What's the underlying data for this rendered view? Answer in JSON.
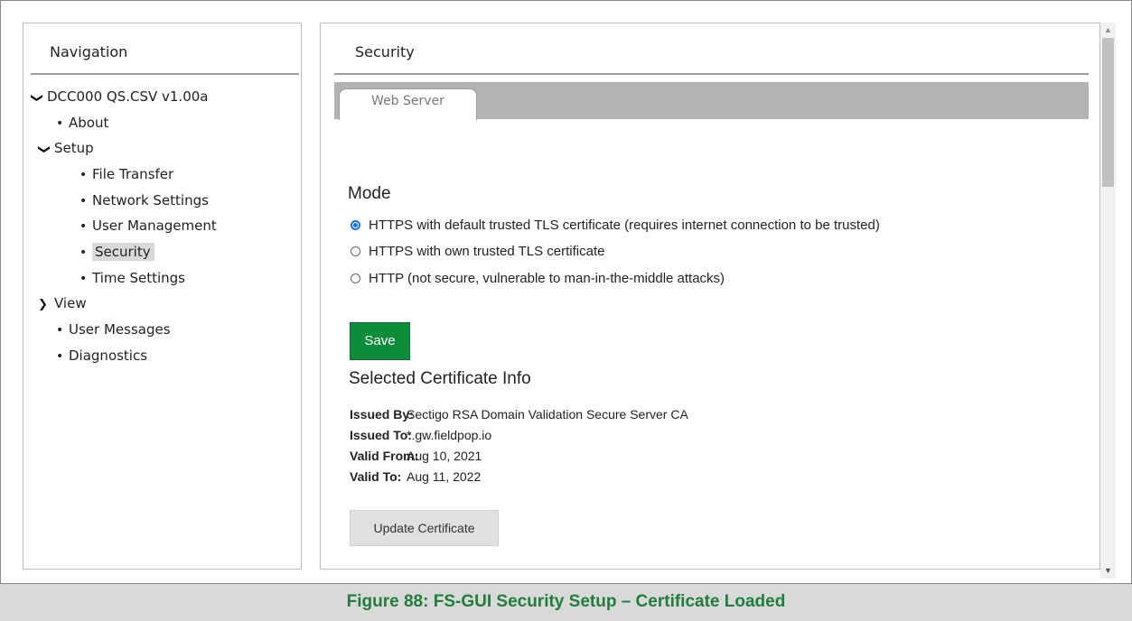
{
  "navigation": {
    "title": "Navigation",
    "items": [
      {
        "label": "DCC000 QS.CSV v1.00a",
        "marker": "❯"
      },
      {
        "label": "About"
      },
      {
        "label": "Setup"
      },
      {
        "label": "File Transfer"
      },
      {
        "label": "Network Settings"
      },
      {
        "label": "User Management"
      },
      {
        "label": "Security"
      },
      {
        "label": "Time Settings"
      },
      {
        "label": "View"
      },
      {
        "label": "User Messages"
      },
      {
        "label": "Diagnostics"
      }
    ]
  },
  "content": {
    "title": "Security",
    "tabs": [
      {
        "label": "Web Server"
      }
    ],
    "mode": {
      "title": "Mode",
      "options": [
        {
          "label": "HTTPS with default trusted TLS certificate (requires internet connection to be trusted)",
          "checked": true
        },
        {
          "label": "HTTPS with own trusted TLS certificate",
          "checked": false
        },
        {
          "label": "HTTP (not secure, vulnerable to man-in-the-middle attacks)",
          "checked": false
        }
      ]
    },
    "save_label": "Save",
    "cert": {
      "title": "Selected Certificate Info",
      "rows": [
        {
          "key": "Issued By:",
          "value": "Sectigo RSA Domain Validation Secure Server CA"
        },
        {
          "key": "Issued To:",
          "value": "*.gw.fieldpop.io"
        },
        {
          "key": "Valid From:",
          "value": "Aug 10, 2021"
        },
        {
          "key": "Valid To:",
          "value": "Aug 11, 2022"
        }
      ]
    },
    "update_label": "Update Certificate"
  },
  "caption": "Figure 88: FS-GUI Security Setup – Certificate Loaded",
  "colors": {
    "save_button": "#0d8c3a",
    "radio_checked": "#1a73e8",
    "caption_text": "#1f7f3a",
    "caption_bg": "#d9d9d9",
    "tab_strip": "#b3b3b3"
  }
}
